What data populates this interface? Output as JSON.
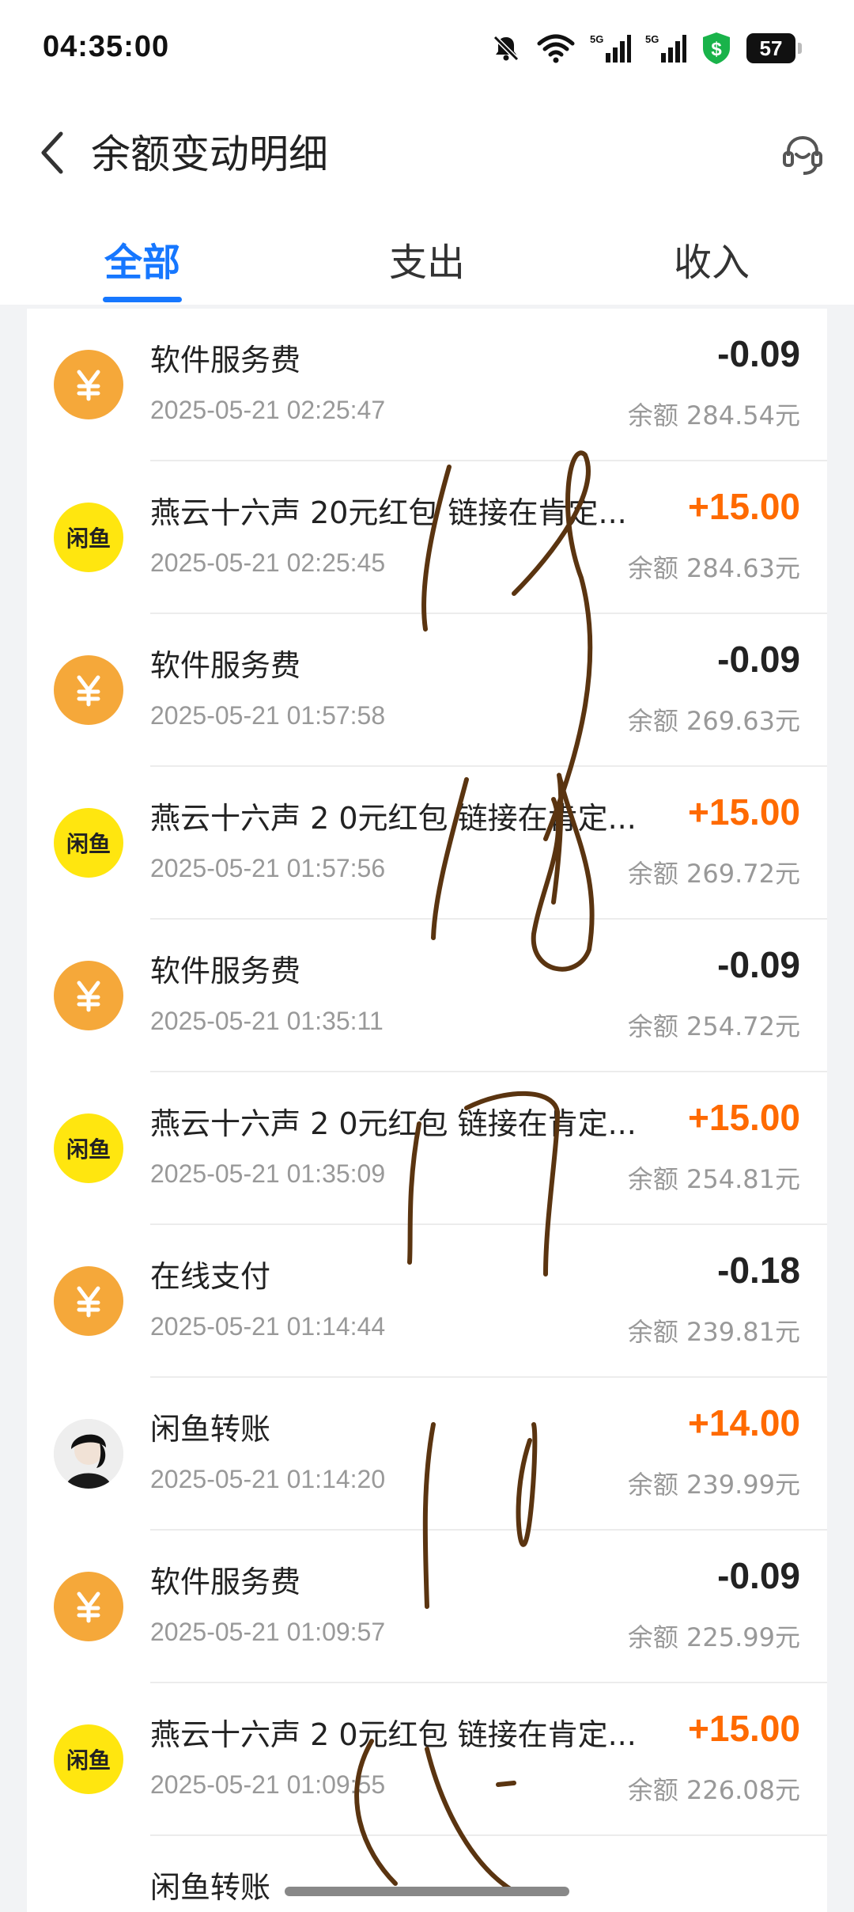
{
  "status_bar": {
    "time": "04:35:00",
    "icons": [
      "bell-muted-icon",
      "wifi-icon",
      "5g-signal-icon",
      "5g-signal-icon",
      "shield-dollar-icon"
    ],
    "network_label": "5G",
    "battery": "57"
  },
  "header": {
    "title": "余额变动明细",
    "back_icon": "chevron-left-icon",
    "service_icon": "customer-service-icon"
  },
  "tabs": [
    {
      "label": "全部",
      "active": true
    },
    {
      "label": "支出",
      "active": false
    },
    {
      "label": "收入",
      "active": false
    }
  ],
  "colors": {
    "accent": "#1677ff",
    "income": "#ff6a00",
    "yuan_icon_bg": "#f5a83a",
    "xianyu_icon_bg": "#ffe60f",
    "scribble": "#5a3410"
  },
  "transactions": [
    {
      "icon": "yuan-icon",
      "title": "软件服务费",
      "time": "2025-05-21 02:25:47",
      "amount": "-0.09",
      "type": "expense",
      "balance": "余额 284.54元"
    },
    {
      "icon": "xianyu-icon",
      "icon_text": "闲鱼",
      "title": "燕云十六声 20元红包 链接在肯定...",
      "time": "2025-05-21 02:25:45",
      "amount": "+15.00",
      "type": "income",
      "balance": "余额 284.63元"
    },
    {
      "icon": "yuan-icon",
      "title": "软件服务费",
      "time": "2025-05-21 01:57:58",
      "amount": "-0.09",
      "type": "expense",
      "balance": "余额 269.63元"
    },
    {
      "icon": "xianyu-icon",
      "icon_text": "闲鱼",
      "title": "燕云十六声 2 0元红包 链接在肯定...",
      "time": "2025-05-21 01:57:56",
      "amount": "+15.00",
      "type": "income",
      "balance": "余额 269.72元"
    },
    {
      "icon": "yuan-icon",
      "title": "软件服务费",
      "time": "2025-05-21 01:35:11",
      "amount": "-0.09",
      "type": "expense",
      "balance": "余额 254.72元"
    },
    {
      "icon": "xianyu-icon",
      "icon_text": "闲鱼",
      "title": "燕云十六声 2 0元红包 链接在肯定...",
      "time": "2025-05-21 01:35:09",
      "amount": "+15.00",
      "type": "income",
      "balance": "余额 254.81元"
    },
    {
      "icon": "yuan-icon",
      "title": "在线支付",
      "time": "2025-05-21 01:14:44",
      "amount": "-0.18",
      "type": "expense",
      "balance": "余额 239.81元"
    },
    {
      "icon": "avatar",
      "title": "闲鱼转账",
      "time": "2025-05-21 01:14:20",
      "amount": "+14.00",
      "type": "income",
      "balance": "余额 239.99元"
    },
    {
      "icon": "yuan-icon",
      "title": "软件服务费",
      "time": "2025-05-21 01:09:57",
      "amount": "-0.09",
      "type": "expense",
      "balance": "余额 225.99元"
    },
    {
      "icon": "xianyu-icon",
      "icon_text": "闲鱼",
      "title": "燕云十六声 2 0元红包 链接在肯定...",
      "time": "2025-05-21 01:09:55",
      "amount": "+15.00",
      "type": "income",
      "balance": "余额 226.08元"
    },
    {
      "icon": "avatar",
      "title": "闲鱼转账",
      "time": "",
      "amount": "",
      "type": "income",
      "balance": ""
    }
  ]
}
